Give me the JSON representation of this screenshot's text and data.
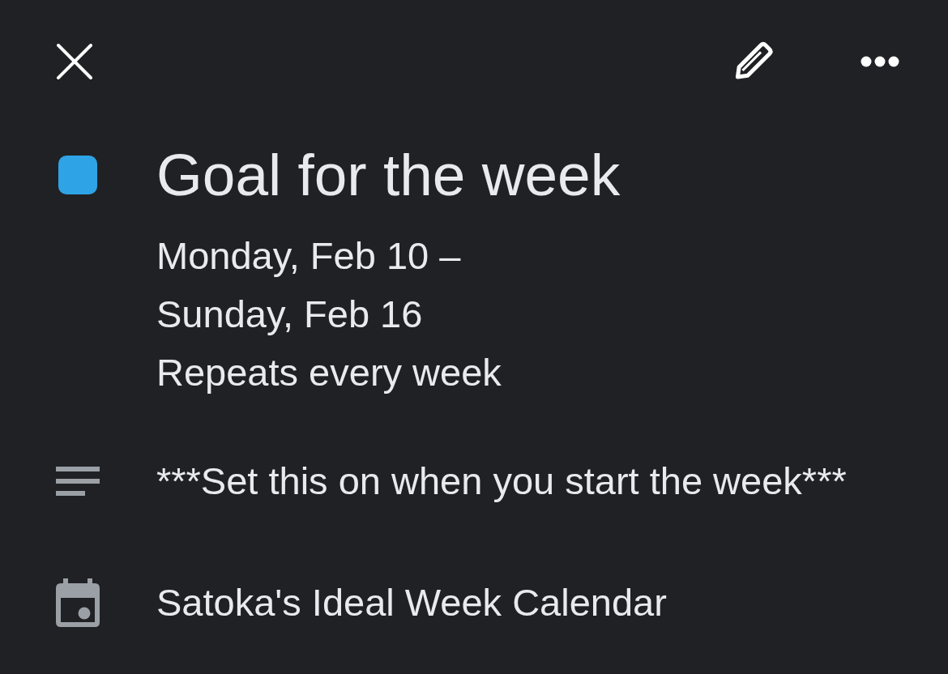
{
  "toolbar": {
    "actions": [
      {
        "kind": "close"
      },
      {
        "kind": "edit"
      },
      {
        "kind": "more"
      }
    ]
  },
  "event": {
    "title": "Goal for the week",
    "color": "#2ea3e6",
    "date_lines": [
      "Monday, Feb 10 –",
      "Sunday, Feb 16"
    ],
    "recurrence": "Repeats every week"
  },
  "details": [
    {
      "kind": "description",
      "text": "***Set this on when you start the week***"
    },
    {
      "kind": "calendar",
      "text": "Satoka's Ideal Week Calendar"
    }
  ]
}
